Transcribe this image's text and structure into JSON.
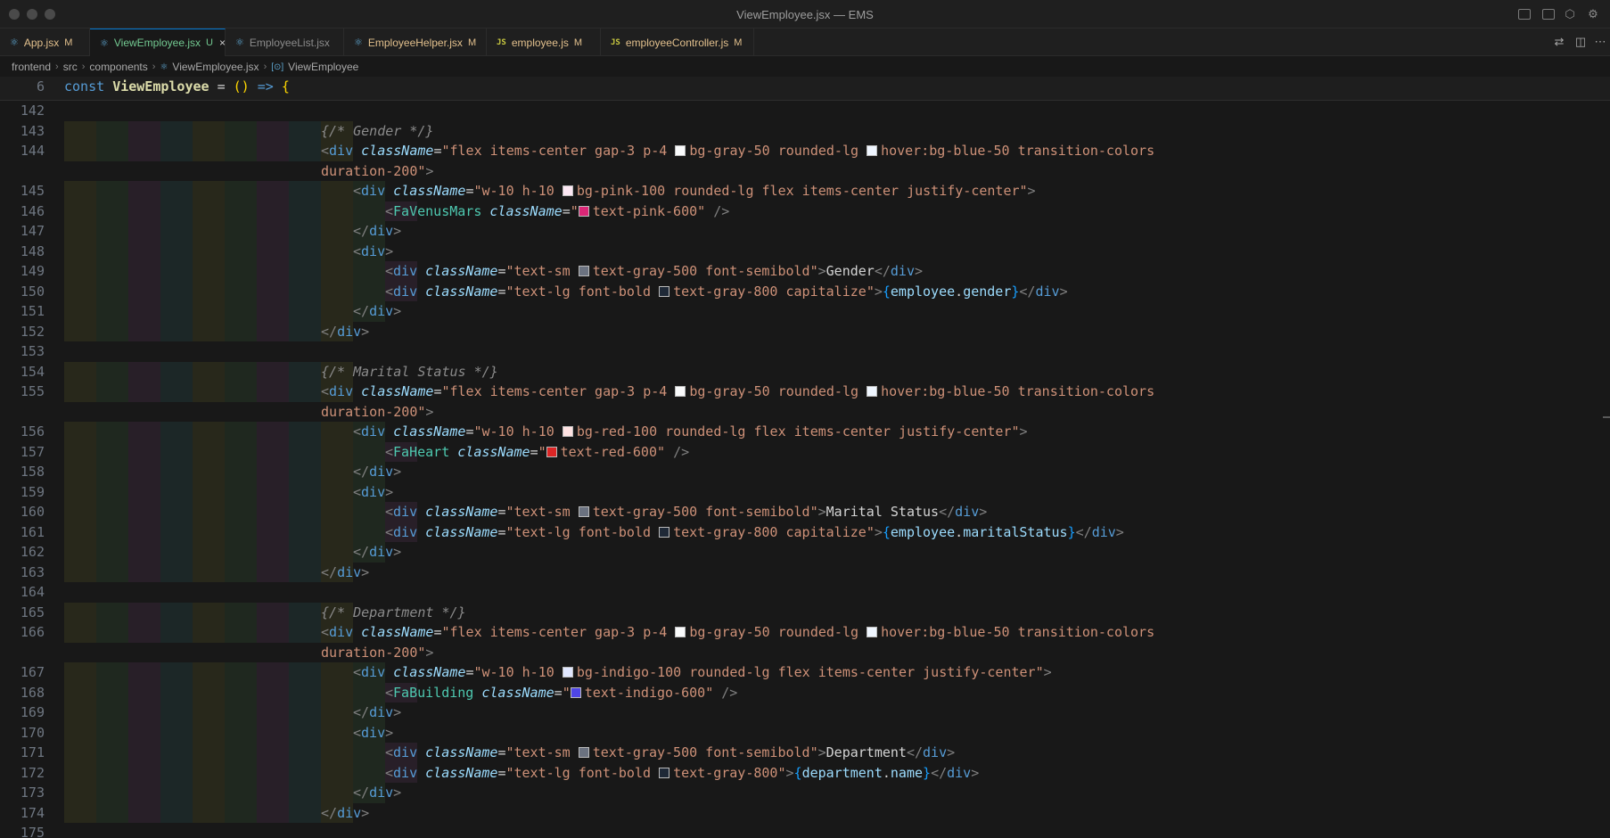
{
  "window": {
    "title": "ViewEmployee.jsx — EMS"
  },
  "tabs": [
    {
      "label": "App.jsx",
      "status": "M",
      "icon": "react-icon",
      "active": false
    },
    {
      "label": "ViewEmployee.jsx",
      "status": "U",
      "icon": "react-icon",
      "active": true
    },
    {
      "label": "EmployeeList.jsx",
      "status": "",
      "icon": "react-icon",
      "active": false
    },
    {
      "label": "EmployeeHelper.jsx",
      "status": "M",
      "icon": "react-icon",
      "active": false
    },
    {
      "label": "employee.js",
      "status": "M",
      "icon": "js-icon",
      "active": false
    },
    {
      "label": "employeeController.js",
      "status": "M",
      "icon": "js-icon",
      "active": false
    }
  ],
  "breadcrumb": [
    "frontend",
    "src",
    "components",
    "ViewEmployee.jsx",
    "ViewEmployee"
  ],
  "sticky": {
    "line": "6",
    "code": "const ViewEmployee = () => {"
  },
  "colors": {
    "accent": "#0078d4",
    "bg": "#181818",
    "pink600": "#db2777",
    "red600": "#dc2626",
    "indigo600": "#4f46e5"
  },
  "sections": [
    {
      "comment_line": "143",
      "comment": "{/* Gender */}",
      "outer_line": "144",
      "outer_class_1": "flex items-center gap-3 p-4 ",
      "outer_bg": "bg-gray-50 rounded-lg ",
      "outer_hover": "hover:bg-blue-50 transition-colors",
      "outer_cont": "duration-200",
      "icon_wrap_line": "145",
      "icon_wrap_pre": "w-10 h-10 ",
      "icon_wrap_bg": "bg-pink-100 rounded-lg flex items-center justify-center",
      "icon_line": "146",
      "icon_comp": "FaVenusMars",
      "icon_color": "text-pink-600",
      "close1_line": "147",
      "open_line": "148",
      "label_line": "149",
      "label_pre": "text-sm ",
      "label_color": "text-gray-500 font-semibold",
      "label_text": "Gender",
      "value_line": "150",
      "value_pre": "text-lg font-bold ",
      "value_color": "text-gray-800 capitalize",
      "value_obj": "employee",
      "value_prop": "gender",
      "close2_line": "151",
      "close3_line": "152",
      "blank_line": "153"
    },
    {
      "comment_line": "154",
      "comment": "{/* Marital Status */}",
      "outer_line": "155",
      "outer_class_1": "flex items-center gap-3 p-4 ",
      "outer_bg": "bg-gray-50 rounded-lg ",
      "outer_hover": "hover:bg-blue-50 transition-colors",
      "outer_cont": "duration-200",
      "icon_wrap_line": "156",
      "icon_wrap_pre": "w-10 h-10 ",
      "icon_wrap_bg": "bg-red-100 rounded-lg flex items-center justify-center",
      "icon_line": "157",
      "icon_comp": "FaHeart",
      "icon_color": "text-red-600",
      "close1_line": "158",
      "open_line": "159",
      "label_line": "160",
      "label_pre": "text-sm ",
      "label_color": "text-gray-500 font-semibold",
      "label_text": "Marital Status",
      "value_line": "161",
      "value_pre": "text-lg font-bold ",
      "value_color": "text-gray-800 capitalize",
      "value_obj": "employee",
      "value_prop": "maritalStatus",
      "close2_line": "162",
      "close3_line": "163",
      "blank_line": "164"
    },
    {
      "comment_line": "165",
      "comment": "{/* Department */}",
      "outer_line": "166",
      "outer_class_1": "flex items-center gap-3 p-4 ",
      "outer_bg": "bg-gray-50 rounded-lg ",
      "outer_hover": "hover:bg-blue-50 transition-colors",
      "outer_cont": "duration-200",
      "icon_wrap_line": "167",
      "icon_wrap_pre": "w-10 h-10 ",
      "icon_wrap_bg": "bg-indigo-100 rounded-lg flex items-center justify-center",
      "icon_line": "168",
      "icon_comp": "FaBuilding",
      "icon_color": "text-indigo-600",
      "close1_line": "169",
      "open_line": "170",
      "label_line": "171",
      "label_pre": "text-sm ",
      "label_color": "text-gray-500 font-semibold",
      "label_text": "Department",
      "value_line": "172",
      "value_pre": "text-lg font-bold ",
      "value_color": "text-gray-800",
      "value_obj": "department",
      "value_prop": "name",
      "close2_line": "173",
      "close3_line": "174",
      "blank_line": "175"
    }
  ],
  "first_line": "142"
}
